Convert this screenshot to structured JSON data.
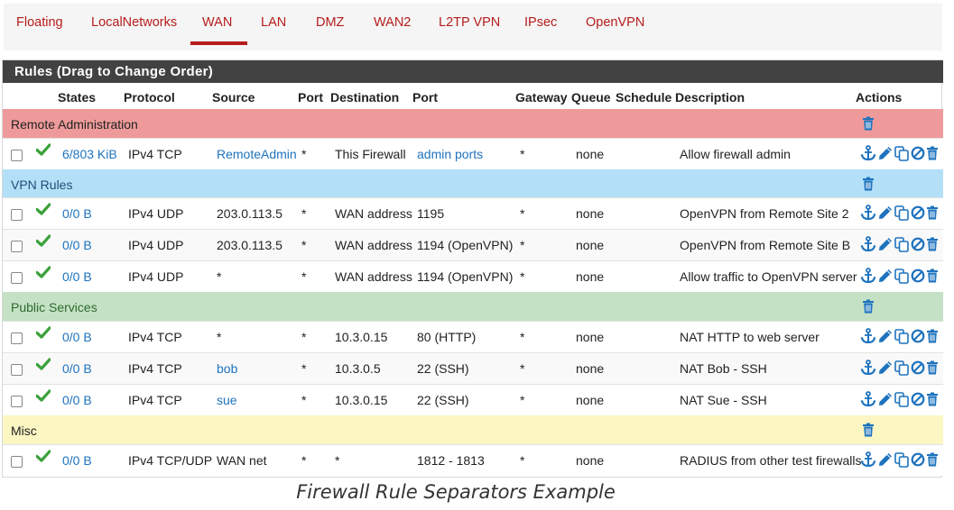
{
  "tabs": [
    "Floating",
    "LocalNetworks",
    "WAN",
    "LAN",
    "DMZ",
    "WAN2",
    "L2TP VPN",
    "IPsec",
    "OpenVPN"
  ],
  "active_tab": "WAN",
  "panel": {
    "title": "Rules (Drag to Change Order)"
  },
  "columns": {
    "states": "States",
    "protocol": "Protocol",
    "source": "Source",
    "port": "Port",
    "destination": "Destination",
    "dport": "Port",
    "gateway": "Gateway",
    "queue": "Queue",
    "schedule": "Schedule",
    "description": "Description",
    "actions": "Actions"
  },
  "separators": {
    "remote": {
      "label": "Remote Administration",
      "color": "#ef9a9a",
      "text_color": "#222222"
    },
    "vpn": {
      "label": "VPN Rules",
      "color": "#b3e0f7",
      "text_color": "#1e4e79"
    },
    "public": {
      "label": "Public Services",
      "color": "#c5e1c5",
      "text_color": "#2e6b2e"
    },
    "misc": {
      "label": "Misc",
      "color": "#fbf6c2",
      "text_color": "#222222"
    }
  },
  "rules": [
    {
      "states": "6/803 KiB",
      "protocol": "IPv4 TCP",
      "source": "RemoteAdmin",
      "port": "*",
      "destination": "This Firewall",
      "dport": "admin ports",
      "gateway": "*",
      "queue": "none",
      "schedule": "",
      "description": "Allow firewall admin"
    },
    {
      "states": "0/0 B",
      "protocol": "IPv4 UDP",
      "source": "203.0.113.5",
      "port": "*",
      "destination": "WAN address",
      "dport": "1195",
      "gateway": "*",
      "queue": "none",
      "schedule": "",
      "description": "OpenVPN from Remote Site 2"
    },
    {
      "states": "0/0 B",
      "protocol": "IPv4 UDP",
      "source": "203.0.113.5",
      "port": "*",
      "destination": "WAN address",
      "dport": "1194 (OpenVPN)",
      "gateway": "*",
      "queue": "none",
      "schedule": "",
      "description": "OpenVPN from Remote Site B"
    },
    {
      "states": "0/0 B",
      "protocol": "IPv4 UDP",
      "source": "*",
      "port": "*",
      "destination": "WAN address",
      "dport": "1194 (OpenVPN)",
      "gateway": "*",
      "queue": "none",
      "schedule": "",
      "description": "Allow traffic to OpenVPN server"
    },
    {
      "states": "0/0 B",
      "protocol": "IPv4 TCP",
      "source": "*",
      "port": "*",
      "destination": "10.3.0.15",
      "dport": "80 (HTTP)",
      "gateway": "*",
      "queue": "none",
      "schedule": "",
      "description": "NAT HTTP to web server"
    },
    {
      "states": "0/0 B",
      "protocol": "IPv4 TCP",
      "source": "bob",
      "port": "*",
      "destination": "10.3.0.5",
      "dport": "22 (SSH)",
      "gateway": "*",
      "queue": "none",
      "schedule": "",
      "description": "NAT Bob - SSH"
    },
    {
      "states": "0/0 B",
      "protocol": "IPv4 TCP",
      "source": "sue",
      "port": "*",
      "destination": "10.3.0.15",
      "dport": "22 (SSH)",
      "gateway": "*",
      "queue": "none",
      "schedule": "",
      "description": "NAT Sue - SSH"
    },
    {
      "states": "0/0 B",
      "protocol": "IPv4 TCP/UDP",
      "source": "WAN net",
      "port": "*",
      "destination": "*",
      "dport": "1812 - 1813",
      "gateway": "*",
      "queue": "none",
      "schedule": "",
      "description": "RADIUS from other test firewalls"
    }
  ],
  "caption": "Firewall Rule Separators Example",
  "icons": [
    "check-icon",
    "anchor-icon",
    "pencil-icon",
    "copy-icon",
    "disable-icon",
    "trash-icon"
  ],
  "colors": {
    "accent_red": "#b71c1c",
    "link_blue": "#1e73be",
    "check_green": "#3aa13a",
    "header_dark": "#424242"
  }
}
